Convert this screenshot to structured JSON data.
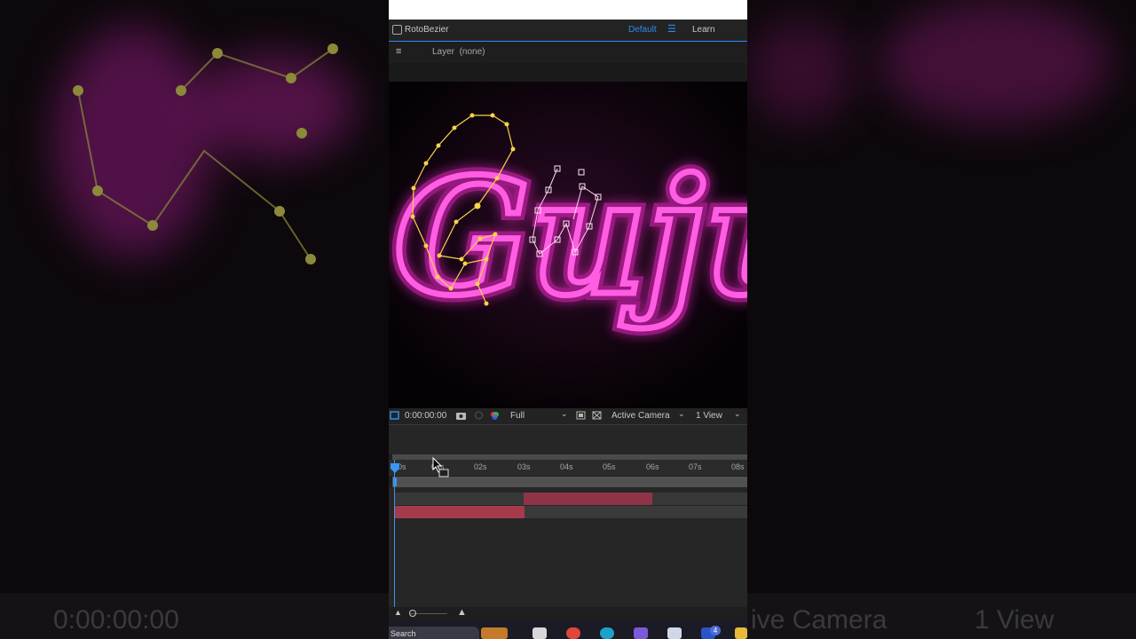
{
  "workspace": {
    "checkbox_label": "RotoBezier",
    "active": "Default",
    "learn": "Learn"
  },
  "composition": {
    "layer_label": "Layer",
    "layer_value": "(none)"
  },
  "viewer": {
    "text": "Guju"
  },
  "controls": {
    "timecode": "0:00:00:00",
    "resolution": "Full",
    "camera": "Active Camera",
    "views": "1 View"
  },
  "timeline": {
    "ticks": [
      "0s",
      "01s",
      "02s",
      "03s",
      "04s",
      "05s",
      "06s",
      "07s",
      "08s"
    ],
    "layer_bars": [
      {
        "color": "#8f3448"
      },
      {
        "color": "#a53a4c"
      }
    ]
  },
  "taskbar": {
    "search": "Search",
    "badge": "4"
  },
  "background": {
    "left_text": "0:00:00:00",
    "right_text_a": "ive Camera",
    "right_text_b": "1 View"
  },
  "colors": {
    "accent": "#2d8ceb",
    "neon": "#ff2bd6",
    "path": "#f5d34a"
  }
}
